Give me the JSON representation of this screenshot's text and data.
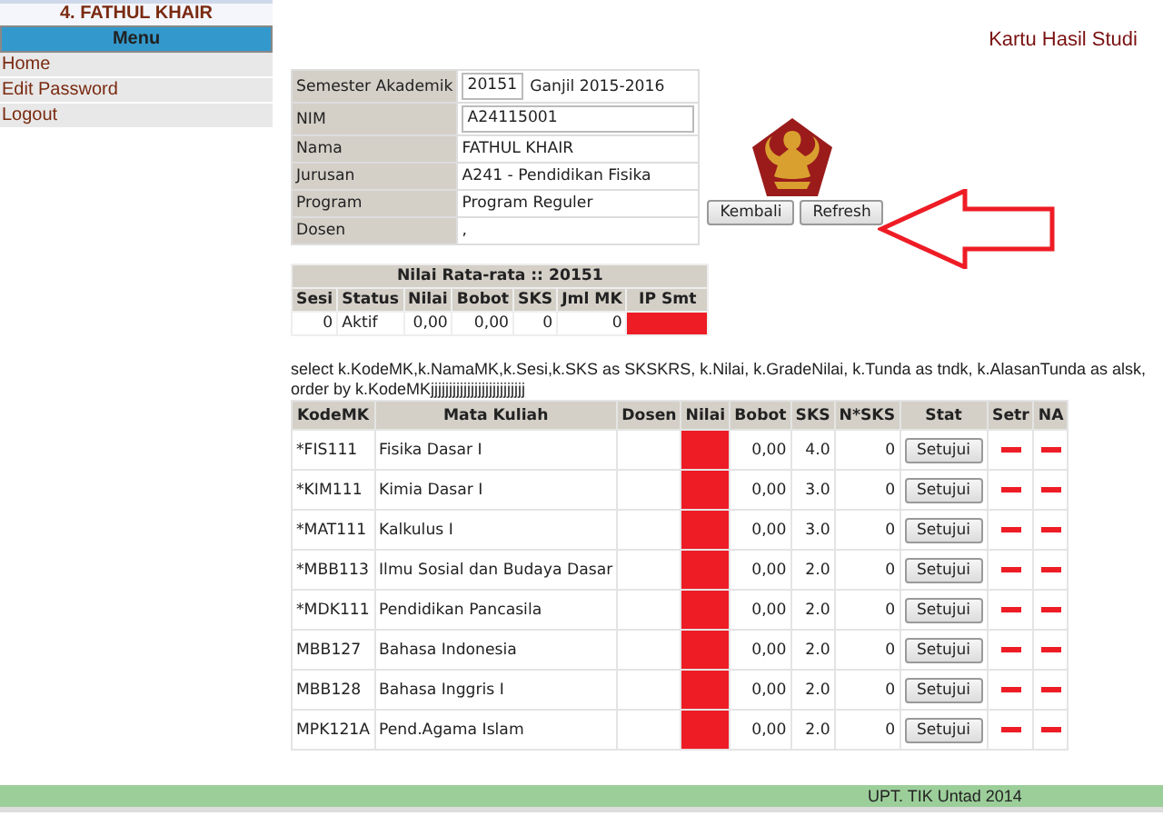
{
  "sidebar": {
    "user": "4. FATHUL KHAIR",
    "menu_title": "Menu",
    "items": [
      {
        "label": "Home"
      },
      {
        "label": "Edit Password"
      },
      {
        "label": "Logout"
      }
    ]
  },
  "page_title": "Kartu Hasil Studi",
  "info": {
    "semester_label": "Semester Akademik",
    "semester_value": "20151",
    "semester_name": "Ganjil 2015-2016",
    "rows": [
      {
        "label": "NIM",
        "value": "A24115001",
        "kind": "input"
      },
      {
        "label": "Nama",
        "value": "FATHUL KHAIR",
        "kind": "text"
      },
      {
        "label": "Jurusan",
        "value": "A241 - Pendidikan Fisika",
        "kind": "text"
      },
      {
        "label": "Program",
        "value": "Program Reguler",
        "kind": "text"
      },
      {
        "label": "Dosen",
        "value": ",",
        "kind": "text"
      }
    ]
  },
  "buttons": [
    "Kembali",
    "Refresh"
  ],
  "summary": {
    "title": "Nilai Rata-rata :: 20151",
    "columns": [
      "Sesi",
      "Status",
      "Nilai",
      "Bobot",
      "SKS",
      "Jml MK",
      "IP Smt"
    ],
    "row": [
      "0",
      "Aktif",
      "0,00",
      "0,00",
      "0",
      "0"
    ]
  },
  "query": {
    "line_1": "select k.KodeMK,k.NamaMK,k.Sesi,k.SKS as SKSKRS, k.Nilai, k.GradeNilai, k.Tunda as tndk, k.AlasanTunda as alsk,",
    "line_2": "order by k.KodeMK",
    "tail": "jjjjjjjjjjjjjjjjjjjjjjjjjj"
  },
  "table": {
    "columns": [
      "KodeMK",
      "Mata Kuliah",
      "Dosen",
      "Nilai",
      "Bobot",
      "SKS",
      "N*SKS",
      "Stat",
      "Setr",
      "NA"
    ],
    "rows": [
      {
        "kode": "*FIS111",
        "mk": "Fisika Dasar I",
        "bobot": "0,00",
        "sks": "4.0",
        "nsks": "0",
        "stat": "Setujui"
      },
      {
        "kode": "*KIM111",
        "mk": "Kimia Dasar I",
        "bobot": "0,00",
        "sks": "3.0",
        "nsks": "0",
        "stat": "Setujui"
      },
      {
        "kode": "*MAT111",
        "mk": "Kalkulus I",
        "bobot": "0,00",
        "sks": "3.0",
        "nsks": "0",
        "stat": "Setujui"
      },
      {
        "kode": "*MBB113",
        "mk": "Ilmu Sosial dan Budaya Dasar",
        "bobot": "0,00",
        "sks": "2.0",
        "nsks": "0",
        "stat": "Setujui"
      },
      {
        "kode": "*MDK111",
        "mk": "Pendidikan Pancasila",
        "bobot": "0,00",
        "sks": "2.0",
        "nsks": "0",
        "stat": "Setujui"
      },
      {
        "kode": "MBB127",
        "mk": "Bahasa Indonesia",
        "bobot": "0,00",
        "sks": "2.0",
        "nsks": "0",
        "stat": "Setujui"
      },
      {
        "kode": "MBB128",
        "mk": "Bahasa Inggris I",
        "bobot": "0,00",
        "sks": "2.0",
        "nsks": "0",
        "stat": "Setujui"
      },
      {
        "kode": "MPK121A",
        "mk": "Pend.Agama Islam",
        "bobot": "0,00",
        "sks": "2.0",
        "nsks": "0",
        "stat": "Setujui"
      }
    ]
  },
  "footer": "UPT. TIK Untad 2014"
}
